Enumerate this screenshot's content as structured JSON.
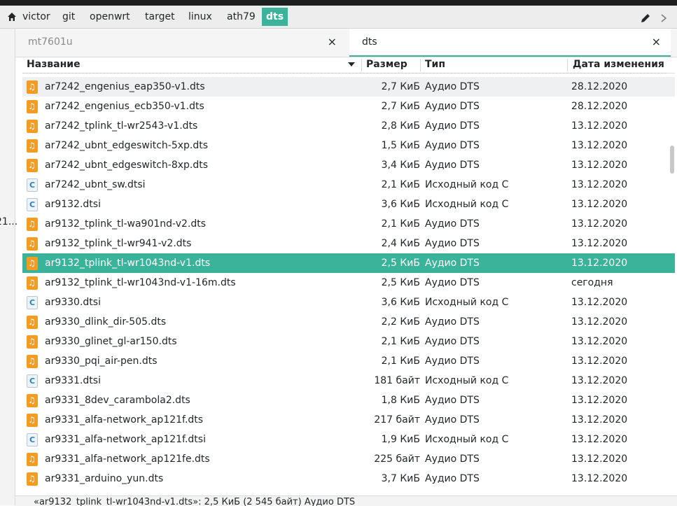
{
  "breadcrumb": {
    "items": [
      "victor",
      "git",
      "openwrt",
      "target",
      "linux",
      "ath79",
      "dts"
    ],
    "active_index": 6
  },
  "left_pane": {
    "truncated_text": "21..."
  },
  "tabs": [
    {
      "label": "mt7601u",
      "close": "×"
    },
    {
      "label": "dts",
      "close": "×"
    }
  ],
  "columns": {
    "name": "Название",
    "size": "Размер",
    "type": "Тип",
    "date": "Дата изменения"
  },
  "files": [
    {
      "name": "ar7242_engenius_eap350-v1.dts",
      "size": "2,7 КиБ",
      "type": "Аудио DTS",
      "date": "28.12.2020",
      "icon": "audio"
    },
    {
      "name": "ar7242_engenius_ecb350-v1.dts",
      "size": "2,7 КиБ",
      "type": "Аудио DTS",
      "date": "28.12.2020",
      "icon": "audio"
    },
    {
      "name": "ar7242_tplink_tl-wr2543-v1.dts",
      "size": "2,8 КиБ",
      "type": "Аудио DTS",
      "date": "13.12.2020",
      "icon": "audio"
    },
    {
      "name": "ar7242_ubnt_edgeswitch-5xp.dts",
      "size": "1,5 КиБ",
      "type": "Аудио DTS",
      "date": "13.12.2020",
      "icon": "audio"
    },
    {
      "name": "ar7242_ubnt_edgeswitch-8xp.dts",
      "size": "3,4 КиБ",
      "type": "Аудио DTS",
      "date": "13.12.2020",
      "icon": "audio"
    },
    {
      "name": "ar7242_ubnt_sw.dtsi",
      "size": "2,1 КиБ",
      "type": "Исходный код C",
      "date": "13.12.2020",
      "icon": "src"
    },
    {
      "name": "ar9132.dtsi",
      "size": "3,6 КиБ",
      "type": "Исходный код C",
      "date": "13.12.2020",
      "icon": "src"
    },
    {
      "name": "ar9132_tplink_tl-wa901nd-v2.dts",
      "size": "2,1 КиБ",
      "type": "Аудио DTS",
      "date": "13.12.2020",
      "icon": "audio"
    },
    {
      "name": "ar9132_tplink_tl-wr941-v2.dts",
      "size": "2,4 КиБ",
      "type": "Аудио DTS",
      "date": "13.12.2020",
      "icon": "audio"
    },
    {
      "name": "ar9132_tplink_tl-wr1043nd-v1.dts",
      "size": "2,5 КиБ",
      "type": "Аудио DTS",
      "date": "13.12.2020",
      "icon": "audio"
    },
    {
      "name": "ar9132_tplink_tl-wr1043nd-v1-16m.dts",
      "size": "2,5 КиБ",
      "type": "Аудио DTS",
      "date": "сегодня",
      "icon": "audio"
    },
    {
      "name": "ar9330.dtsi",
      "size": "3,6 КиБ",
      "type": "Исходный код C",
      "date": "13.12.2020",
      "icon": "src"
    },
    {
      "name": "ar9330_dlink_dir-505.dts",
      "size": "2,2 КиБ",
      "type": "Аудио DTS",
      "date": "13.12.2020",
      "icon": "audio"
    },
    {
      "name": "ar9330_glinet_gl-ar150.dts",
      "size": "2,1 КиБ",
      "type": "Аудио DTS",
      "date": "13.12.2020",
      "icon": "audio"
    },
    {
      "name": "ar9330_pqi_air-pen.dts",
      "size": "2,1 КиБ",
      "type": "Аудио DTS",
      "date": "13.12.2020",
      "icon": "audio"
    },
    {
      "name": "ar9331.dtsi",
      "size": "181 байт",
      "type": "Исходный код C",
      "date": "13.12.2020",
      "icon": "src"
    },
    {
      "name": "ar9331_8dev_carambola2.dts",
      "size": "1,8 КиБ",
      "type": "Аудио DTS",
      "date": "13.12.2020",
      "icon": "audio"
    },
    {
      "name": "ar9331_alfa-network_ap121f.dts",
      "size": "217 байт",
      "type": "Аудио DTS",
      "date": "13.12.2020",
      "icon": "audio"
    },
    {
      "name": "ar9331_alfa-network_ap121f.dtsi",
      "size": "1,9 КиБ",
      "type": "Исходный код C",
      "date": "13.12.2020",
      "icon": "src"
    },
    {
      "name": "ar9331_alfa-network_ap121fe.dts",
      "size": "225 байт",
      "type": "Аудио DTS",
      "date": "13.12.2020",
      "icon": "audio"
    },
    {
      "name": "ar9331_arduino_yun.dts",
      "size": "3,7 КиБ",
      "type": "Аудио DTS",
      "date": "13.12.2020",
      "icon": "audio"
    }
  ],
  "hover_index": 0,
  "selected_index": 9,
  "status_text": "«ar9132_tplink_tl-wr1043nd-v1.dts»: 2,5 КиБ (2 545 байт) Аудио DTS",
  "colors": {
    "accent": "#3bb39a",
    "audio_icon": "#f39c1f"
  }
}
